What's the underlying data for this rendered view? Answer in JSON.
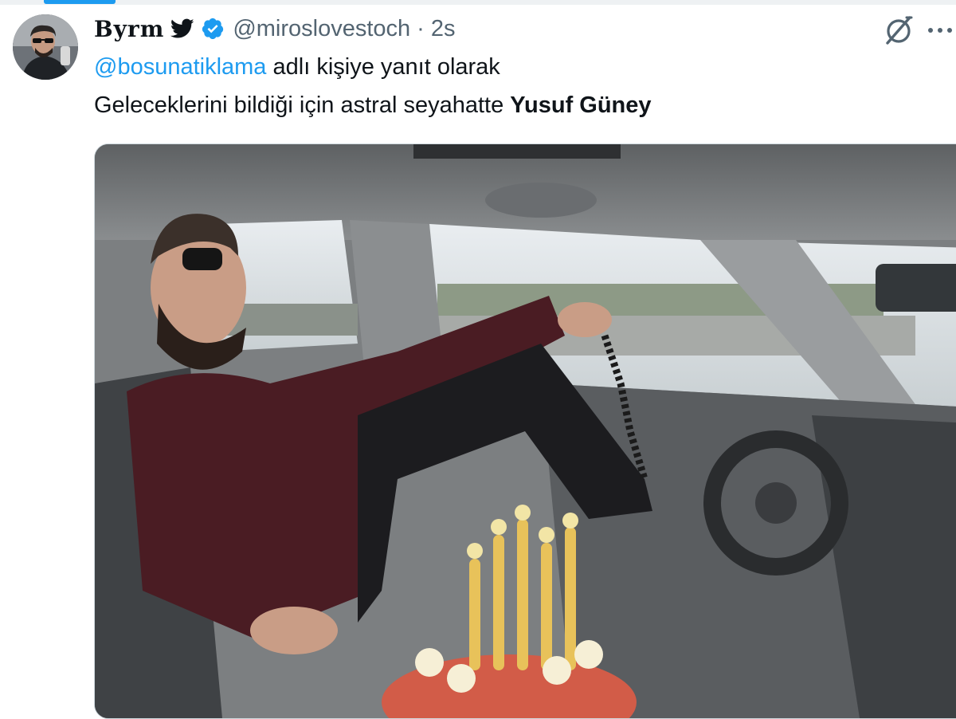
{
  "tweet": {
    "display_name": "Byrm",
    "handle": "@miroslovestoch",
    "separator": "·",
    "time": "2s",
    "reply_mention": "@bosunatiklama",
    "reply_suffix": " adlı kişiye yanıt olarak",
    "text_plain": "Geleceklerini bildiği için astral seyahatte ",
    "text_bold": "Yusuf Güney",
    "media_kind": "video"
  },
  "icons": {
    "bird": "twitter-bird-icon",
    "verified": "verified-badge-icon",
    "grok": "grok-icon",
    "more": "more-options-icon"
  },
  "colors": {
    "link": "#1d9bf0",
    "secondary_text": "#536471",
    "primary_text": "#0f1419",
    "verified": "#1d9bf0"
  }
}
